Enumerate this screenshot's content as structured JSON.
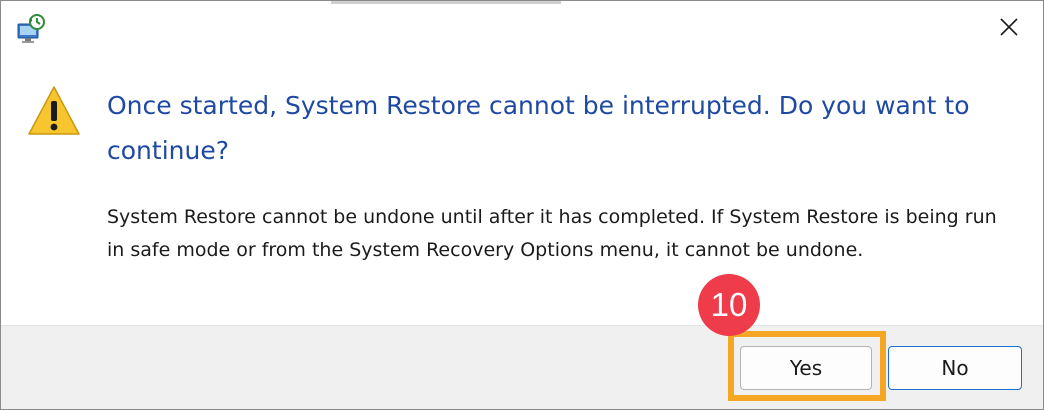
{
  "dialog": {
    "heading": "Once started, System Restore cannot be interrupted. Do you want to continue?",
    "body": "System Restore cannot be undone until after it has completed. If System Restore is being run in safe mode or from the System Recovery Options menu, it cannot be undone.",
    "icons": {
      "app": "system-restore-icon",
      "warning": "warning-icon",
      "close": "close-icon"
    }
  },
  "buttons": {
    "yes_label": "Yes",
    "no_label": "No"
  },
  "annotation": {
    "step_number": "10",
    "highlight_color": "#f5a623",
    "badge_color": "#ee3c4a"
  },
  "colors": {
    "heading": "#1f4aa3",
    "footer_bg": "#f0f0f0",
    "default_button_border": "#1f6fd0"
  }
}
